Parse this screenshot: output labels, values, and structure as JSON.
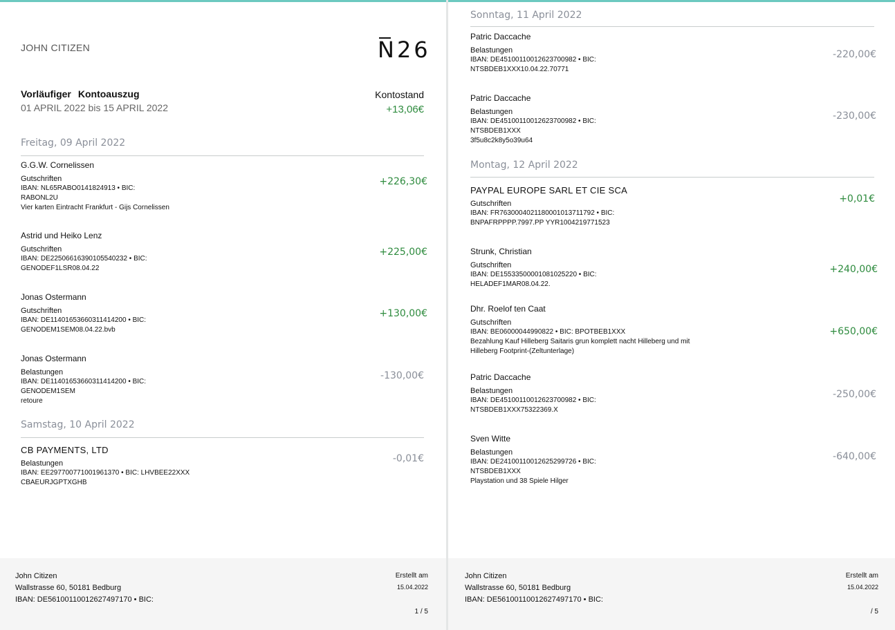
{
  "header": {
    "owner_name": "JOHN CITIZEN",
    "logo_text": "N26",
    "statement_title_1": "Vorläufiger",
    "statement_title_2": "Kontoauszug",
    "period": "01 APRIL 2022 bis 15 APRIL 2022",
    "balance_label": "Kontostand",
    "balance_value": "+13,06€"
  },
  "left": {
    "day1": "Freitag, 09 April 2022",
    "t1": {
      "name": "G.G.W. Cornelissen",
      "type": "Gutschriften",
      "l1": "IBAN: NL65RABO0141824913 • BIC:",
      "l2": "RABONL2U",
      "l3": "Vier karten Eintracht Frankfurt - Gijs Cornelissen",
      "amount": "+226,30€"
    },
    "t2": {
      "name": "Astrid und Heiko Lenz",
      "type": "Gutschriften",
      "l1": "IBAN: DE22506616390105540232 • BIC:",
      "l2": "GENODEF1LSR08.04.22",
      "amount": "+225,00€"
    },
    "t3": {
      "name": "Jonas Ostermann",
      "type": "Gutschriften",
      "l1": "IBAN: DE11401653660311414200 • BIC:",
      "l2": "GENODEM1SEM08.04.22.bvb",
      "amount": "+130,00€"
    },
    "t4": {
      "name": "Jonas Ostermann",
      "type": "Belastungen",
      "l1": "IBAN: DE11401653660311414200 • BIC:",
      "l2": "GENODEM1SEM",
      "l3": "retoure",
      "amount": "-130,00€"
    },
    "day2": "Samstag, 10 April 2022",
    "t5": {
      "name": "CB PAYMENTS, LTD",
      "type": "Belastungen",
      "l1": "IBAN: EE297700771001961370 • BIC: LHVBEE22XXX",
      "l2": "CBAEURJGPTXGHB",
      "amount": "-0,01€"
    }
  },
  "right": {
    "day1": "Sonntag, 11 April 2022",
    "t1": {
      "name": "Patric Daccache",
      "type": "Belastungen",
      "l1": "IBAN: DE45100110012623700982 • BIC:",
      "l2": "NTSBDEB1XXX10.04.22.70771",
      "amount": "-220,00€"
    },
    "t2": {
      "name": "Patric Daccache",
      "type": "Belastungen",
      "l1": "IBAN: DE45100110012623700982 • BIC:",
      "l2": "NTSBDEB1XXX",
      "l3": "3f5u8c2k8y5o39u64",
      "amount": "-230,00€"
    },
    "day2": "Montag, 12 April 2022",
    "t3": {
      "name": "PAYPAL EUROPE SARL ET CIE SCA",
      "type": "Gutschriften",
      "l1": "IBAN: FR7630004021180001013711792 • BIC:",
      "l2": "BNPAFRPPPP.7997.PP YYR1004219771523",
      "amount": "+0,01€"
    },
    "t4": {
      "name": "Strunk, Christian",
      "type": "Gutschriften",
      "l1": "IBAN: DE15533500001081025220 • BIC:",
      "l2": "HELADEF1MAR08.04.22.",
      "amount": "+240,00€"
    },
    "t5": {
      "name": "Dhr. Roelof ten Caat",
      "type": "Gutschriften",
      "l1": "IBAN: BE06000044990822 • BIC: BPOTBEB1XXX",
      "l2": "Bezahlung Kauf Hilleberg Saitaris grun komplett nacht Hilleberg und mit",
      "l3": "Hilleberg Footprint-(Zeltunterlage)",
      "amount": "+650,00€"
    },
    "t6": {
      "name": "Patric Daccache",
      "type": "Belastungen",
      "l1": "IBAN: DE45100110012623700982 • BIC:",
      "l2": "NTSBDEB1XXX75322369.X",
      "amount": "-250,00€"
    },
    "t7": {
      "name": "Sven Witte",
      "type": "Belastungen",
      "l1": "IBAN: DE24100110012625299726 • BIC:",
      "l2": "NTSBDEB1XXX",
      "l3": "Playstation und 38 Spiele Hilger",
      "amount": "-640,00€"
    }
  },
  "footer": {
    "name": "John Citizen",
    "address": "Wallstrasse 60, 50181 Bedburg",
    "iban": "IBAN:  DE56100110012627497170  •  BIC:",
    "created_label": "Erstellt  am",
    "created_date": "15.04.2022",
    "page_left": "1 / 5",
    "page_right": "/ 5"
  },
  "colors": {
    "accent_bar": "#6cc9c0",
    "positive": "#2e8b3e",
    "negative": "#8a8f99"
  }
}
